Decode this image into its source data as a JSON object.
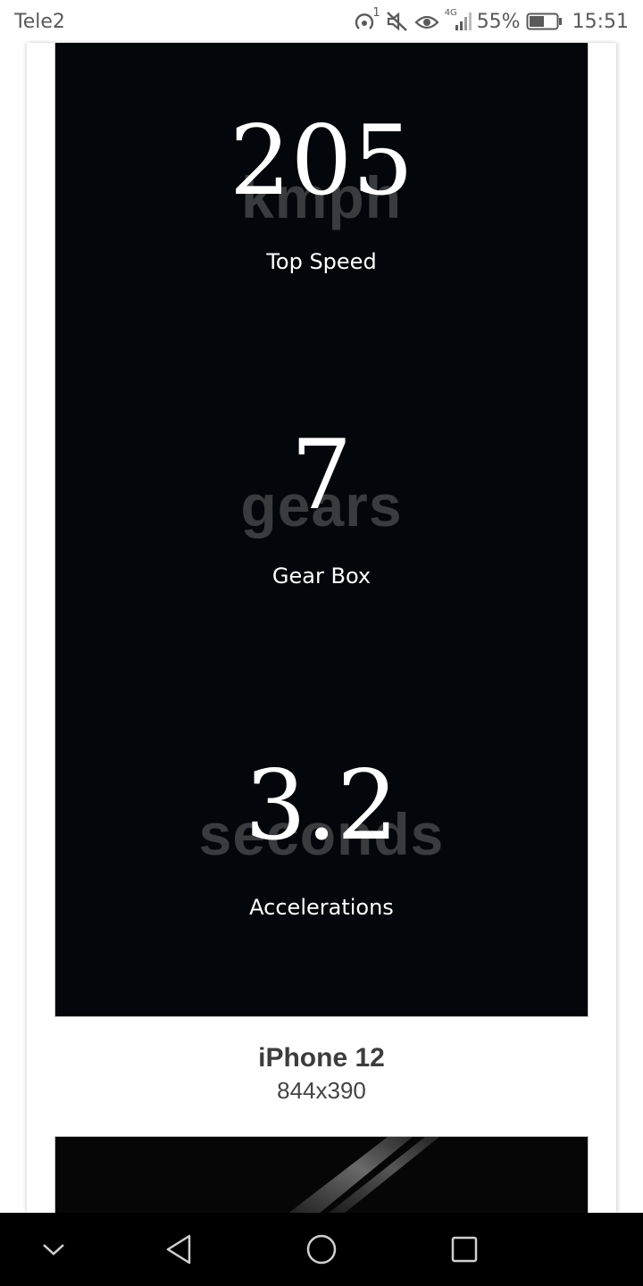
{
  "status_bar": {
    "carrier": "Tele2",
    "hotspot_badge": "1",
    "network_type": "4G",
    "battery_percent": "55%",
    "battery_level": 0.55,
    "time": "15:51",
    "icons": [
      "hotspot-icon",
      "mute-icon",
      "eye-comfort-icon",
      "signal-icon",
      "battery-icon"
    ]
  },
  "preview": {
    "stats": [
      {
        "number": "205",
        "unit": "kmph",
        "label": "Top Speed"
      },
      {
        "number": "7",
        "unit": "gears",
        "label": "Gear Box"
      },
      {
        "number": "3.2",
        "unit": "seconds",
        "label": "Accelerations"
      }
    ]
  },
  "device": {
    "name": "iPhone 12",
    "size": "844x390"
  },
  "nav_bar": {
    "icons": [
      "chevron-down-icon",
      "back-icon",
      "home-icon",
      "recents-icon"
    ]
  }
}
